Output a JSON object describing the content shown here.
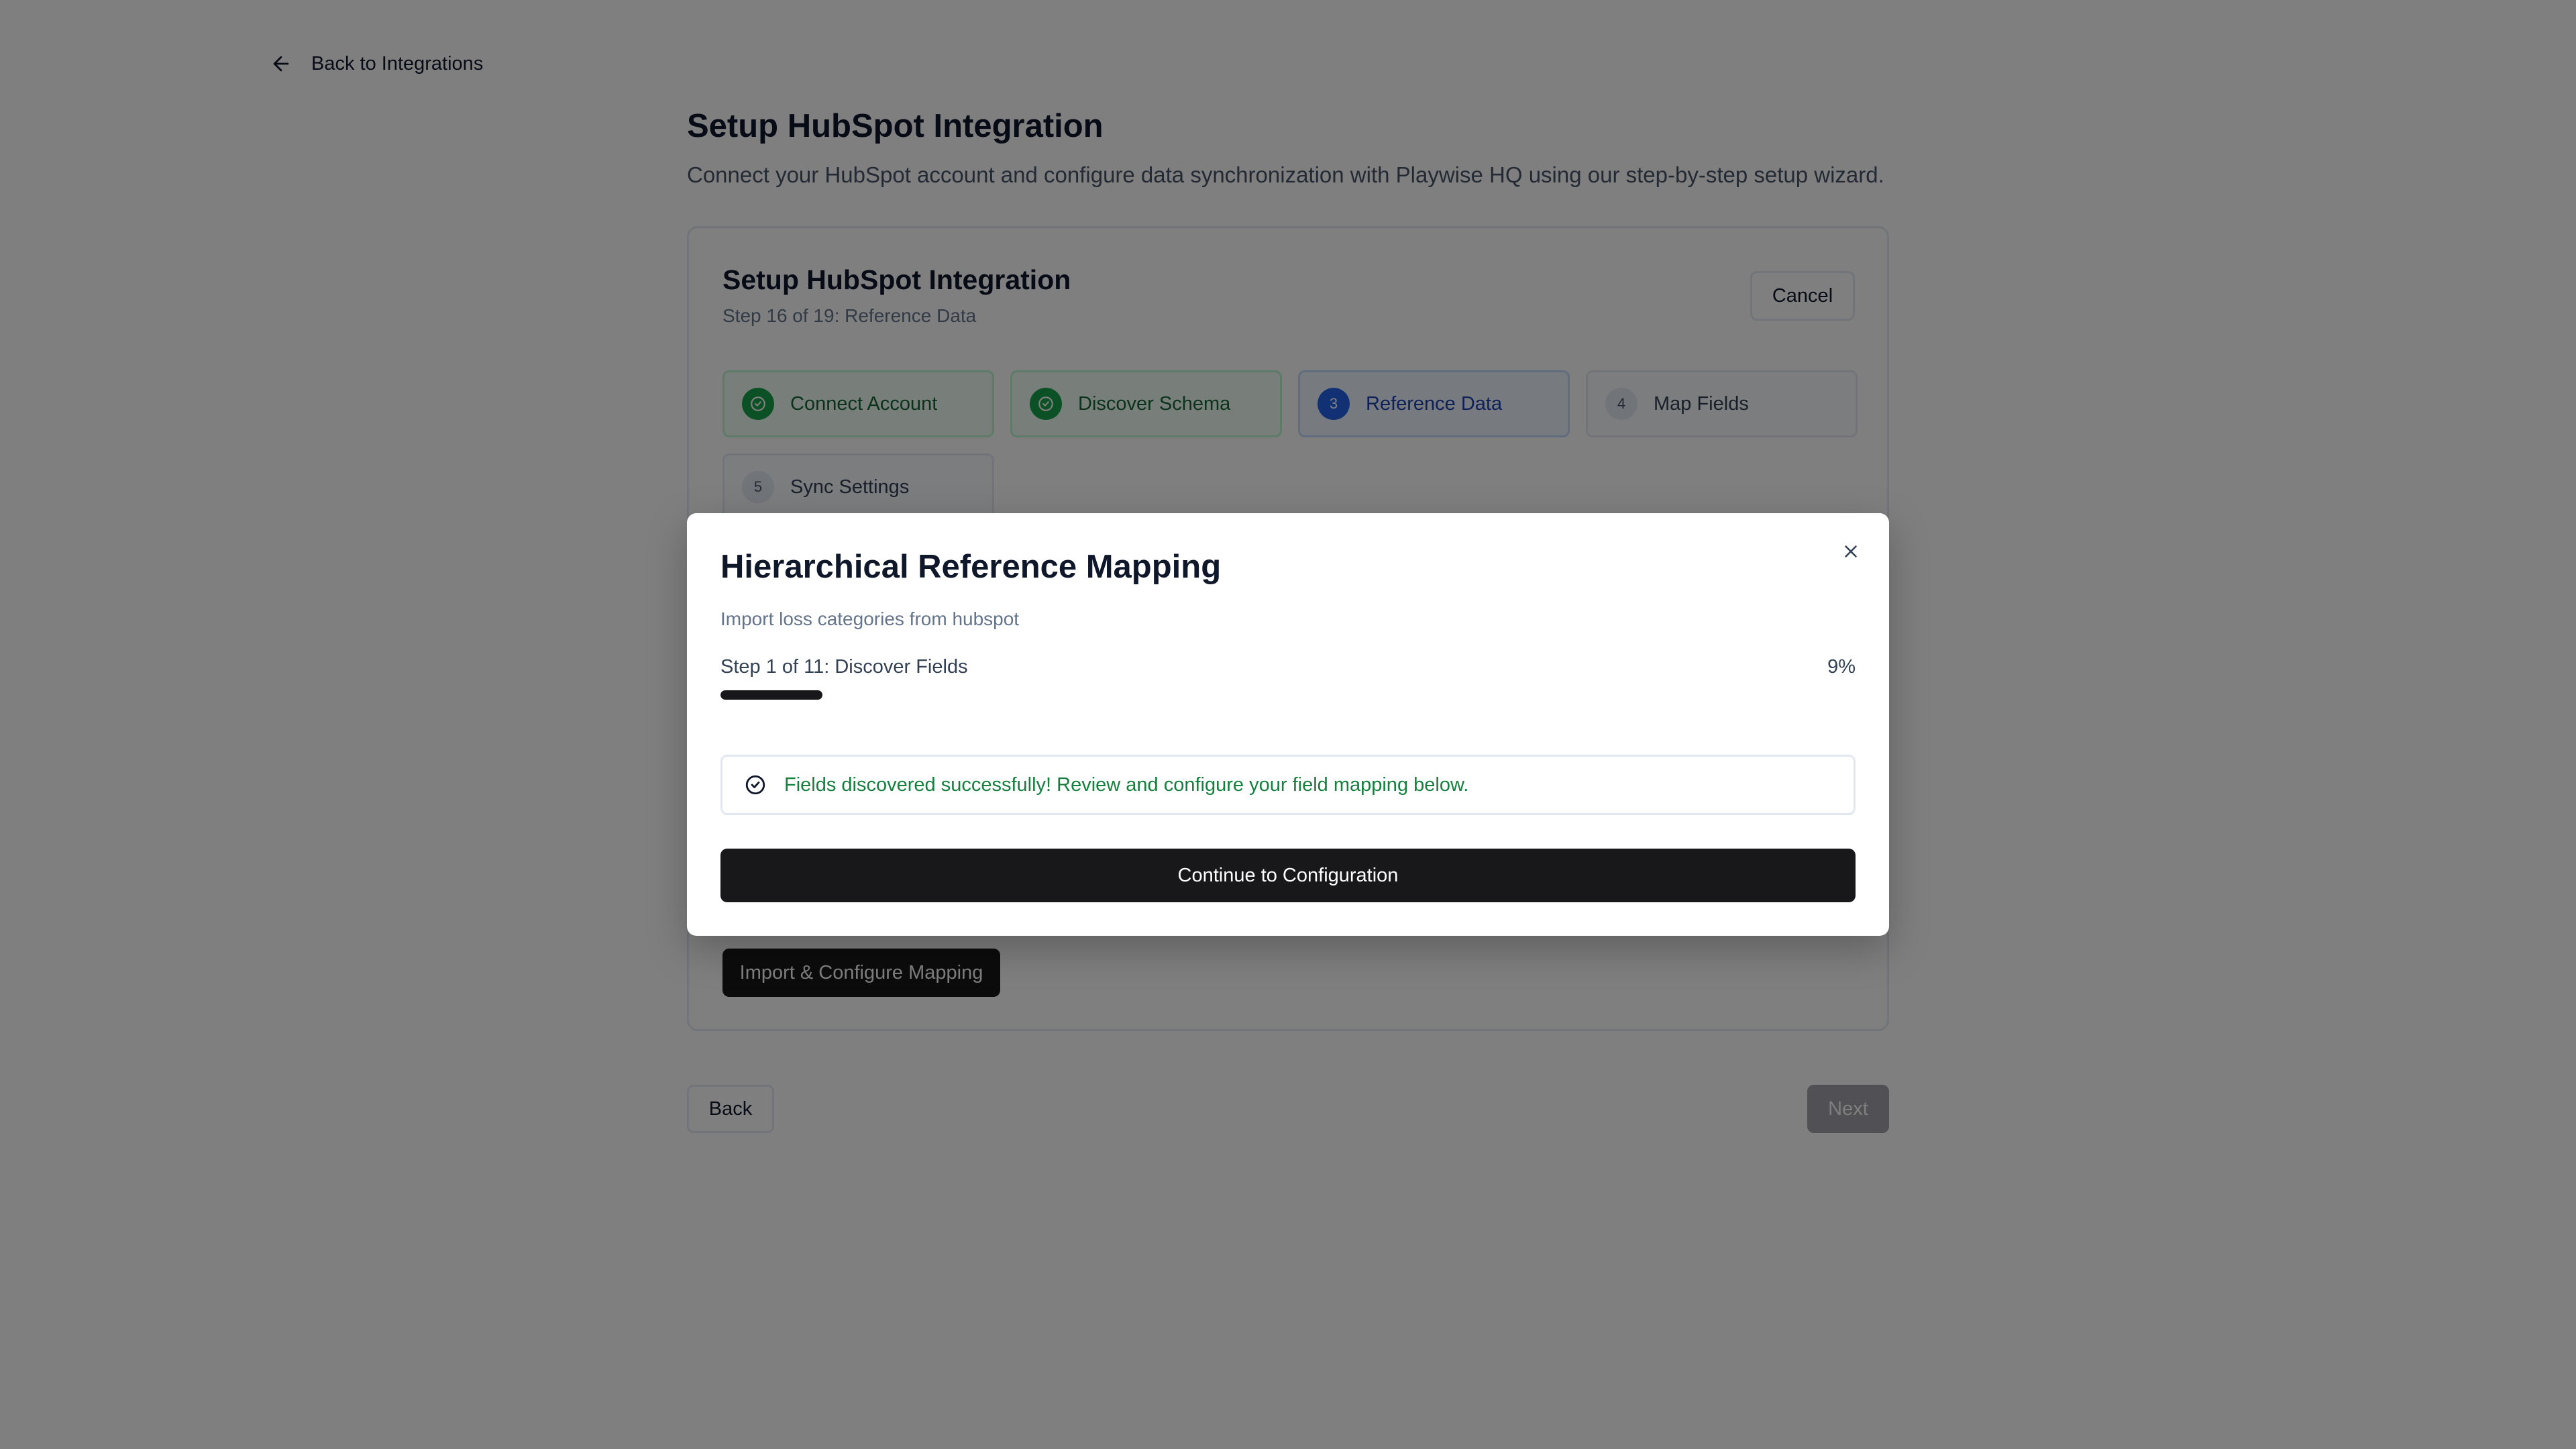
{
  "nav": {
    "back_label": "Back to Integrations"
  },
  "page": {
    "title": "Setup HubSpot Integration",
    "subtitle": "Connect your HubSpot account and configure data synchronization with Playwise HQ using our step-by-step setup wizard."
  },
  "card": {
    "title": "Setup HubSpot Integration",
    "step_text": "Step 16 of 19: Reference Data",
    "cancel_label": "Cancel",
    "steps": [
      {
        "num": "1",
        "label": "Connect Account",
        "status": "done"
      },
      {
        "num": "2",
        "label": "Discover Schema",
        "status": "done"
      },
      {
        "num": "3",
        "label": "Reference Data",
        "status": "active"
      },
      {
        "num": "4",
        "label": "Map Fields",
        "status": "pending"
      },
      {
        "num": "5",
        "label": "Sync Settings",
        "status": "pending"
      }
    ],
    "import_label": "Import & Configure Mapping"
  },
  "footer": {
    "back_label": "Back",
    "next_label": "Next"
  },
  "modal": {
    "title": "Hierarchical Reference Mapping",
    "subtitle": "Import loss categories from hubspot",
    "progress_label": "Step 1 of 11: Discover Fields",
    "progress_pct": "9%",
    "progress_value": 0.09,
    "alert_text": "Fields discovered successfully! Review and configure your field mapping below.",
    "continue_label": "Continue to Configuration"
  },
  "colors": {
    "success": "#16a34a",
    "active": "#2563eb",
    "primary_button": "#18181b"
  }
}
